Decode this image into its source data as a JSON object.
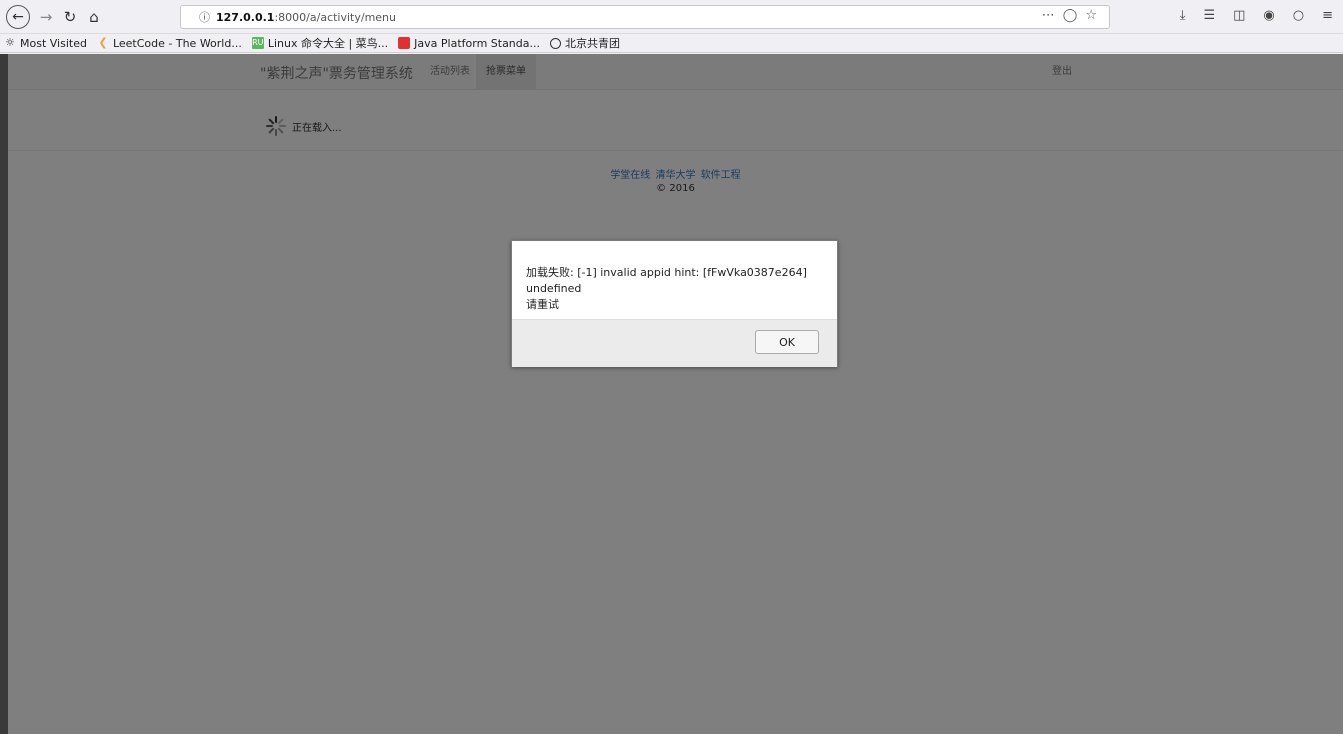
{
  "browser": {
    "url_host": "127.0.0.1",
    "url_path": ":8000/a/activity/menu",
    "url_info_icon": "info-icon",
    "bookmarks": [
      {
        "label": "Most Visited",
        "icon": "star-gear-icon"
      },
      {
        "label": "LeetCode - The World...",
        "icon": "leetcode-icon"
      },
      {
        "label": "Linux 命令大全 | 菜鸟...",
        "icon": "runoob-icon"
      },
      {
        "label": "Java Platform Standa...",
        "icon": "oracle-icon"
      },
      {
        "label": "北京共青团",
        "icon": "globe-icon"
      }
    ]
  },
  "app": {
    "brand": "\"紫荆之声\"票务管理系统",
    "nav": {
      "activities": "活动列表",
      "grab_menu": "抢票菜单"
    },
    "logout": "登出",
    "loading_text": "正在载入..."
  },
  "footer": {
    "links": [
      "学堂在线",
      "清华大学",
      "软件工程"
    ],
    "copyright": "© 2016"
  },
  "dialog": {
    "message_line1": "加载失败: [-1] invalid appid hint: [fFwVka0387e264] undefined",
    "message_line2": "请重试",
    "ok_label": "OK"
  }
}
